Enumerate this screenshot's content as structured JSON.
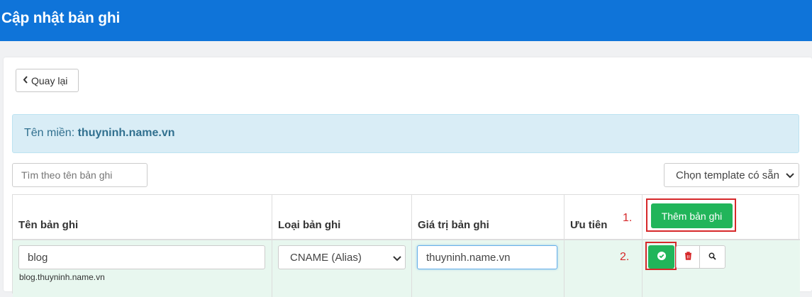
{
  "header": {
    "title": "Cập nhật bản ghi"
  },
  "toolbar": {
    "back_label": "Quay lại"
  },
  "domain": {
    "label": "Tên miền:",
    "value": "thuyninh.name.vn"
  },
  "search": {
    "placeholder": "Tìm theo tên bản ghi"
  },
  "template_select": {
    "selected": "Chọn template có sẵn"
  },
  "table": {
    "columns": [
      "Tên bản ghi",
      "Loại bản ghi",
      "Giá trị bản ghi",
      "Ưu tiên"
    ],
    "add_button_label": "Thêm bản ghi",
    "rows": [
      {
        "name": "blog",
        "fqdn": "blog.thuyninh.name.vn",
        "type": "CNAME (Alias)",
        "value": "thuyninh.name.vn",
        "priority": ""
      }
    ]
  },
  "annotations": {
    "step1": "1.",
    "step2": "2."
  },
  "colors": {
    "header_bg": "#0f74d9",
    "accent_green": "#21b55a",
    "annotation_red": "#d6282a",
    "info_bg": "#d9edf6"
  }
}
